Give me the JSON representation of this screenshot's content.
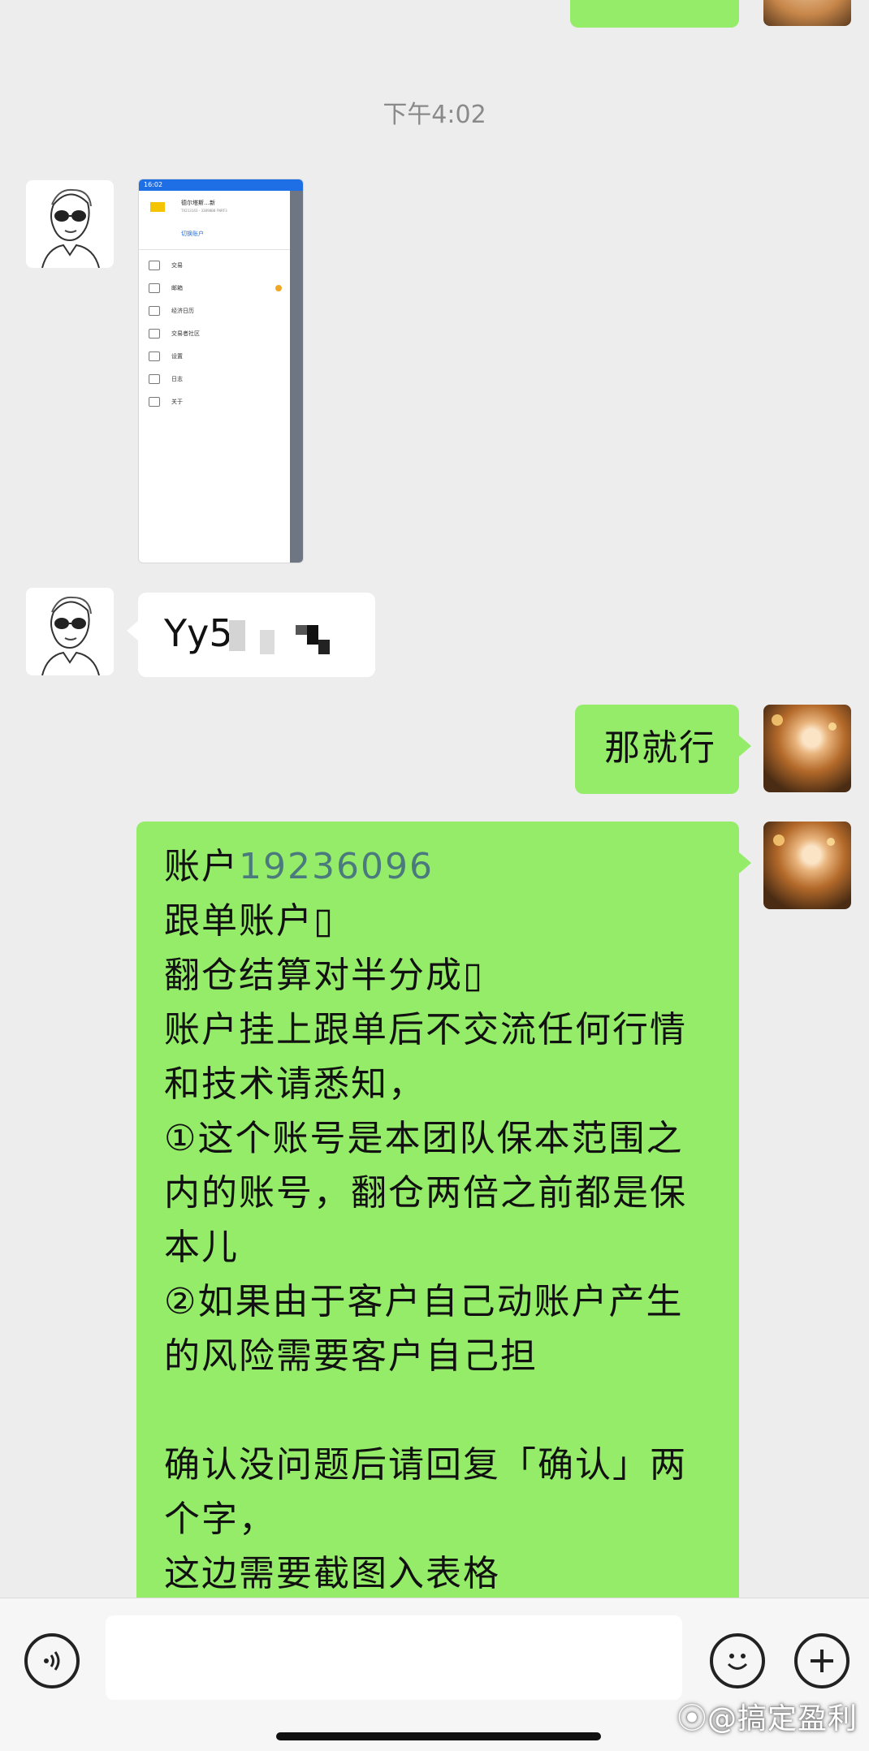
{
  "timestamp": "下午4:02",
  "screenshot_thumbnail": {
    "status_time": "16:02",
    "account_name": "德尔塔斯…新",
    "account_sub": "TX213143 - 33898B8 FNRF3",
    "switch_account": "切换账户",
    "menu": [
      {
        "label": "交易",
        "icon": "trade-icon"
      },
      {
        "label": "邮箱",
        "icon": "mail-icon"
      },
      {
        "label": "经济日历",
        "icon": "calendar-icon"
      },
      {
        "label": "交易者社区",
        "icon": "community-icon"
      },
      {
        "label": "设置",
        "icon": "settings-icon"
      },
      {
        "label": "日志",
        "icon": "log-icon"
      },
      {
        "label": "关于",
        "icon": "about-icon"
      }
    ]
  },
  "messages": {
    "partial_text": "Yy5",
    "short_reply": "那就行",
    "long_prefix": "账户",
    "account_number": "19236096",
    "long_rest": "\n跟单账户▯\n翻仓结算对半分成▯\n账户挂上跟单后不交流任何行情\n和技术请悉知，\n①这个账号是本团队保本范围之\n内的账号，翻仓两倍之前都是保\n本儿\n②如果由于客户自己动账户产生\n的风险需要客户自己担\n\n确认没问题后请回复「确认」两\n个字，\n这边需要截图入表格"
  },
  "input_bar": {
    "voice_icon": "voice-icon",
    "emoji_icon": "emoji-icon",
    "plus_icon": "plus-icon"
  },
  "watermark": "⦿@搞定盈利",
  "colors": {
    "background": "#ededed",
    "sent_bubble": "#95ec69",
    "received_bubble": "#ffffff",
    "account_number": "#4a7a7d"
  }
}
